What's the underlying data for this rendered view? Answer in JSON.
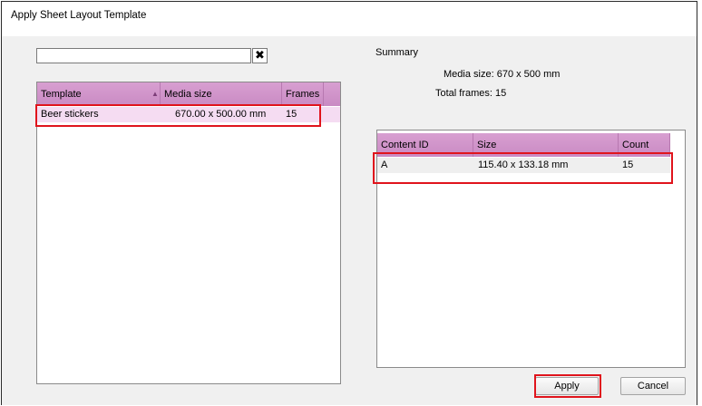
{
  "window": {
    "title": "Apply Sheet Layout Template"
  },
  "search": {
    "value": "",
    "clear_symbol": "✖"
  },
  "templates_table": {
    "headers": [
      "Template",
      "Media size",
      "Frames"
    ],
    "sort_indicator": "▲",
    "rows": [
      {
        "template": "Beer stickers",
        "media_size": "670.00 x 500.00 mm",
        "frames": "15"
      }
    ]
  },
  "summary": {
    "title": "Summary",
    "media_size_label": "Media size:",
    "media_size_value": "670 x 500 mm",
    "total_frames_label": "Total frames:",
    "total_frames_value": "15"
  },
  "content_table": {
    "headers": [
      "Content ID",
      "Size",
      "Count"
    ],
    "rows": [
      {
        "content_id": "A",
        "size": "115.40 x 133.18 mm",
        "count": "15"
      }
    ]
  },
  "buttons": {
    "apply": "Apply",
    "cancel": "Cancel"
  },
  "colors": {
    "header_accent": "#c98ac3",
    "selected_row": "#f5dcf2",
    "highlight": "#e0141c"
  }
}
